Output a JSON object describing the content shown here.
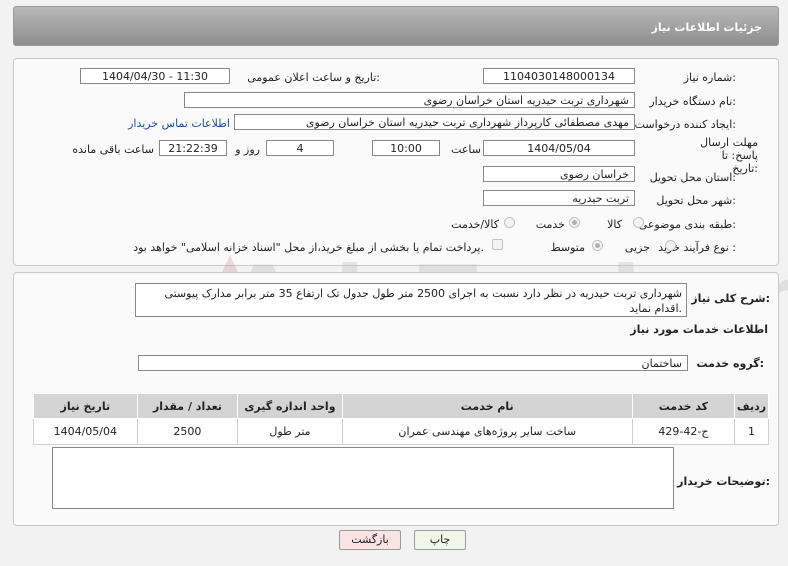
{
  "header": {
    "title": "جزئیات اطلاعات نیاز"
  },
  "form": {
    "need_number_label": "شماره نیاز:",
    "need_number": "1104030148000134",
    "announce_label": "تاریخ و ساعت اعلان عمومی:",
    "announce_value": "1404/04/30 - 11:30",
    "buyer_org_label": "نام دستگاه خریدار:",
    "buyer_org": "شهرداری تربت حیدریه استان خراسان رضوی",
    "requester_label": "ایجاد کننده درخواست:",
    "requester": "مهدی مصطفائی کارپرداز شهرداری تربت حیدریه استان خراسان رضوی",
    "contact_link": "اطلاعات تماس خریدار",
    "deadline_label": "مهلت ارسال پاسخ: تا تاریخ:",
    "deadline_date": "1404/05/04",
    "time_label": "ساعت",
    "deadline_time": "10:00",
    "days_value": "4",
    "days_label": "روز و",
    "remaining_time": "21:22:39",
    "remaining_label": "ساعت باقی مانده",
    "province_label": "استان محل تحویل:",
    "province": "خراسان رضوی",
    "city_label": "شهر محل تحویل:",
    "city": "تربت حیدریه",
    "category_label": "طبقه بندی موضوعی:",
    "category_options": [
      "کالا",
      "خدمت",
      "کالا/خدمت"
    ],
    "process_label": "نوع فرآیند خرید :",
    "process_options": [
      "جزیی",
      "متوسط"
    ],
    "payment_note": "پرداخت تمام یا بخشی از مبلغ خرید،از محل \"اسناد خزانه اسلامی\" خواهد بود."
  },
  "description": {
    "label": "شرح کلی نیاز:",
    "text": "شهرداری تربت حیدریه در نظر دارد نسبت به اجرای 2500 متر طول جدول تک ارتفاع 35 متر برابر مدارک پیوستی اقدام نماید."
  },
  "services": {
    "section_title": "اطلاعات خدمات مورد نیاز",
    "group_label": "گروه خدمت:",
    "group_value": "ساختمان",
    "columns": [
      "ردیف",
      "کد خدمت",
      "نام خدمت",
      "واحد اندازه گیری",
      "تعداد / مقدار",
      "تاریخ نیاز"
    ],
    "rows": [
      {
        "row": "1",
        "code": "ج-42-429",
        "name": "ساخت سایر پروژه‌های مهندسی عمران",
        "unit": "متر طول",
        "qty": "2500",
        "date": "1404/05/04"
      }
    ]
  },
  "notes": {
    "label": "توضیحات خریدار:"
  },
  "buttons": {
    "print": "چاپ",
    "back": "بازگشت"
  },
  "watermark": {
    "text": "AriaTender.neT"
  },
  "colors": {
    "header_bg": "#9e9e9e",
    "link": "#1a4fa0",
    "back_button_bg": "#fbe3e3",
    "print_button_bg": "#eef7e8"
  }
}
